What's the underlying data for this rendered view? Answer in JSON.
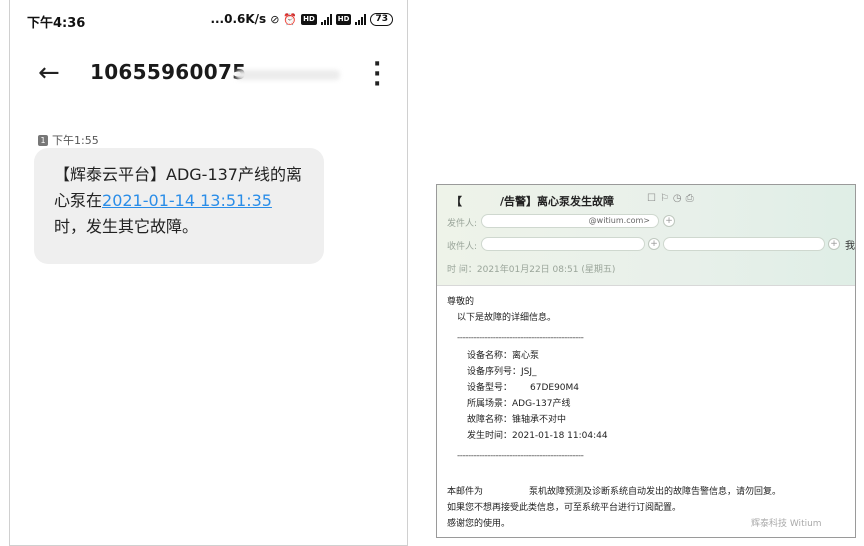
{
  "phone": {
    "status_time": "下午4:36",
    "net_speed": "...0.6K/s",
    "battery": "73",
    "contact_number": "10655960075",
    "sim_label": "1",
    "message_time": "下午1:55",
    "message": {
      "part1": "【辉泰云平台】ADG-137产线的离",
      "part2_prefix": "心泵在",
      "timestamp_link": "2021-01-14 13:51:35",
      "part3": "时，发生其它故障。"
    }
  },
  "email": {
    "subject_prefix": "【",
    "subject": "/告警】离心泵发生故障",
    "from_label": "发件人:",
    "from_value": "@witium.com>",
    "to_label": "收件人:",
    "overflow_char": "我",
    "date_line": "时  间：2021年01月22日 08:51 (星期五)",
    "greeting": "尊敬的",
    "intro": "以下是故障的详细信息。",
    "separator": "----------------------------------------------",
    "details": [
      {
        "label": "设备名称：",
        "value": "离心泵"
      },
      {
        "label": "设备序列号：",
        "value": "JSJ_"
      },
      {
        "label": "设备型号：",
        "value": "67DE90M4"
      },
      {
        "label": "所属场景：",
        "value": "ADG-137产线"
      },
      {
        "label": "故障名称：",
        "value": "锥轴承不对中"
      },
      {
        "label": "发生时间：",
        "value": "2021-01-18 11:04:44"
      }
    ],
    "footer1_a": "本邮件为",
    "footer1_b": "泵机故障预测及诊断系统自动发出的故障告警信息，请勿回复。",
    "footer2": "如果您不想再接受此类信息，可至系统平台进行订阅配置。",
    "footer3": "感谢您的使用。",
    "watermark": "辉泰科技 Witium"
  }
}
